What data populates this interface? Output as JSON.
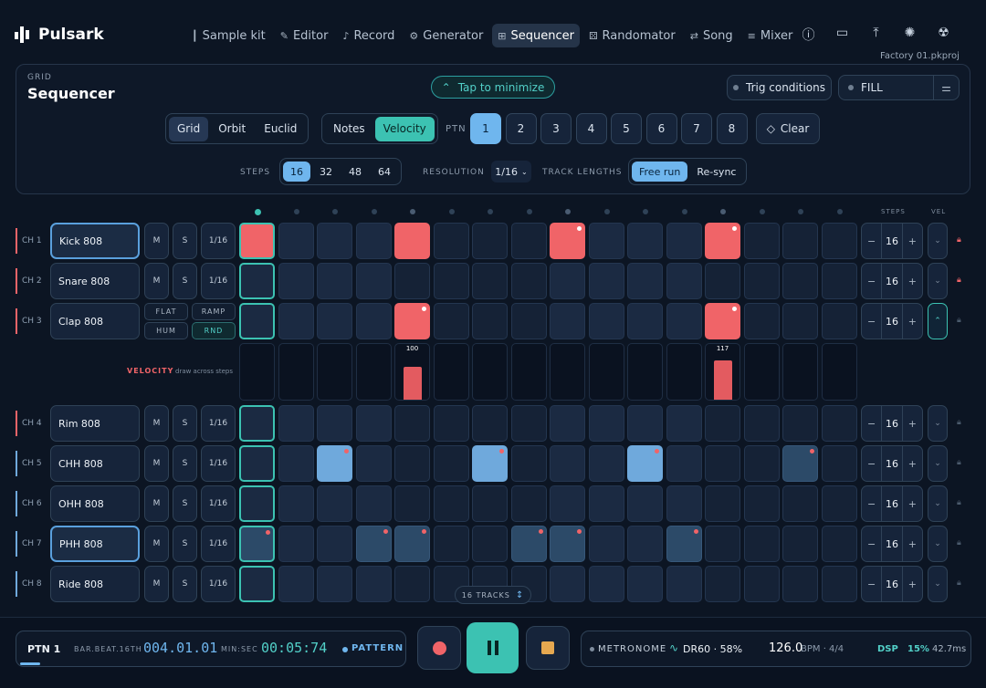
{
  "app": {
    "name": "Pulsark",
    "project": "Factory 01.pkproj"
  },
  "nav": [
    {
      "label": "Sample kit",
      "icon": "waveform-icon"
    },
    {
      "label": "Editor",
      "icon": "pencil-icon"
    },
    {
      "label": "Record",
      "icon": "microphone-icon"
    },
    {
      "label": "Generator",
      "icon": "robot-icon"
    },
    {
      "label": "Sequencer",
      "icon": "grid-icon",
      "active": true
    },
    {
      "label": "Randomator",
      "icon": "dice-icon"
    },
    {
      "label": "Song",
      "icon": "repeat-icon"
    },
    {
      "label": "Mixer",
      "icon": "sliders-icon"
    }
  ],
  "panel": {
    "section": "GRID",
    "title": "Sequencer",
    "minimize": "Tap to minimize",
    "trig": "Trig conditions",
    "fill": "FILL",
    "modes": [
      "Grid",
      "Orbit",
      "Euclid"
    ],
    "mode_active": "Grid",
    "views": [
      "Notes",
      "Velocity"
    ],
    "view_active": "Velocity",
    "ptn_label": "PTN",
    "patterns": [
      "1",
      "2",
      "3",
      "4",
      "5",
      "6",
      "7",
      "8"
    ],
    "pattern_active": "1",
    "clear": "Clear",
    "steps_label": "STEPS",
    "steps": [
      "16",
      "32",
      "48",
      "64"
    ],
    "steps_active": "16",
    "res_label": "RESOLUTION",
    "resolution": "1/16",
    "tl_label": "TRACK LENGTHS",
    "tl": [
      "Free run",
      "Re-sync"
    ],
    "tl_active": "Free run"
  },
  "grid": {
    "steps_head": "STEPS",
    "vel_head": "VEL",
    "velocity_label": "VELOCITY",
    "velocity_hint": "draw across steps",
    "tracks_btn": "16 TRACKS",
    "channels": [
      {
        "ch": "CH 1",
        "name": "Kick 808",
        "color": "#f06468",
        "m": "M",
        "s": "S",
        "res": "1/16",
        "steps": "16",
        "locked": true,
        "selected": true,
        "cells": [
          "red",
          "",
          "",
          "",
          "red",
          "d",
          "d",
          "d",
          "red",
          "",
          "",
          "",
          "red",
          "d",
          "d",
          "d"
        ],
        "pips": [
          8,
          12
        ]
      },
      {
        "ch": "CH 2",
        "name": "Snare 808",
        "color": "#f06468",
        "m": "M",
        "s": "S",
        "res": "1/16",
        "steps": "16",
        "locked": true,
        "cells": [
          "",
          "",
          "",
          "",
          "d",
          "d",
          "d",
          "d",
          "",
          "",
          "",
          "",
          "d",
          "d",
          "d",
          "d"
        ],
        "pips": []
      },
      {
        "ch": "CH 3",
        "name": "Clap 808",
        "color": "#f06468",
        "modes": [
          "FLAT",
          "RAMP",
          "HUM",
          "RND"
        ],
        "steps": "16",
        "open": true,
        "cells": [
          "",
          "",
          "",
          "",
          "red",
          "d",
          "d",
          "d",
          "",
          "",
          "",
          "",
          "red",
          "d",
          "d",
          "d"
        ],
        "pips": [
          4,
          12
        ],
        "velocity": [
          {
            "step": 4,
            "value": 100
          },
          {
            "step": 12,
            "value": 117
          }
        ]
      },
      {
        "ch": "CH 4",
        "name": "Rim 808",
        "color": "#f06468",
        "m": "M",
        "s": "S",
        "res": "1/16",
        "steps": "16",
        "cells": [
          "",
          "",
          "",
          "",
          "d",
          "d",
          "d",
          "d",
          "",
          "",
          "",
          "",
          "d",
          "d",
          "d",
          "d"
        ],
        "pips": []
      },
      {
        "ch": "CH 5",
        "name": "CHH 808",
        "color": "#6fa9dc",
        "m": "M",
        "s": "S",
        "res": "1/16",
        "steps": "16",
        "cells": [
          "",
          "",
          "blue",
          "",
          "d",
          "d",
          "blue",
          "d",
          "",
          "",
          "blue",
          "",
          "d",
          "d",
          "bluedim",
          "d"
        ],
        "pips": [
          2,
          6,
          10,
          14
        ]
      },
      {
        "ch": "CH 6",
        "name": "OHH 808",
        "color": "#6fa9dc",
        "m": "M",
        "s": "S",
        "res": "1/16",
        "steps": "16",
        "cells": [
          "",
          "",
          "",
          "",
          "d",
          "d",
          "d",
          "d",
          "",
          "",
          "",
          "",
          "d",
          "d",
          "d",
          "d"
        ],
        "pips": []
      },
      {
        "ch": "CH 7",
        "name": "PHH 808",
        "color": "#6fa9dc",
        "m": "M",
        "s": "S",
        "res": "1/16",
        "steps": "16",
        "selected": true,
        "cells": [
          "bluedim",
          "",
          "",
          "bluedim",
          "bluedim",
          "d",
          "d",
          "bluedim",
          "bluedim",
          "",
          "",
          "bluedim",
          "d",
          "d",
          "d",
          "d"
        ],
        "pips": [
          0,
          3,
          4,
          7,
          8,
          11
        ]
      },
      {
        "ch": "CH 8",
        "name": "Ride 808",
        "color": "#6fa9dc",
        "m": "M",
        "s": "S",
        "res": "1/16",
        "steps": "16",
        "cells": [
          "",
          "",
          "",
          "",
          "d",
          "d",
          "d",
          "d",
          "",
          "",
          "",
          "",
          "d",
          "d",
          "d",
          "d"
        ],
        "pips": []
      }
    ]
  },
  "transport": {
    "ptn": "PTN 1",
    "pos_label": "BAR.BEAT.16TH",
    "pos": "004.01.01",
    "time_label": "MIN:SEC",
    "time": "00:05:74",
    "mode": "PATTERN",
    "metronome": "METRONOME",
    "kit": "DR60 · 58%",
    "bpm": "126.0",
    "bpm_unit": "BPM · 4/4",
    "dsp": "DSP",
    "dsp_pct": "15%",
    "latency": "42.7ms"
  }
}
